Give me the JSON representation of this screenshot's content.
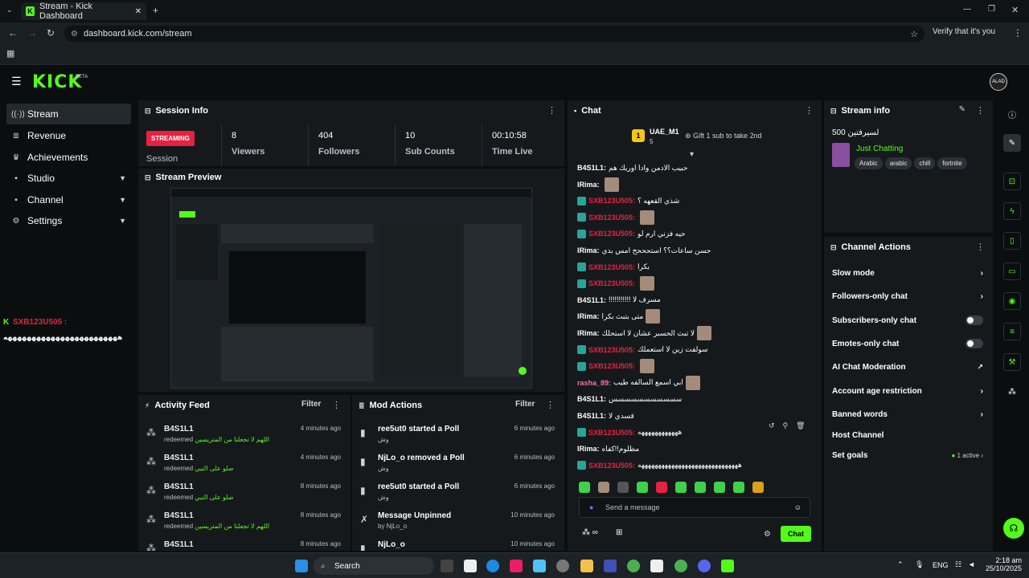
{
  "browser": {
    "tab_title": "Stream - Kick Dashboard",
    "url": "dashboard.kick.com/stream",
    "verify": "Verify that it's you"
  },
  "app": {
    "logo": "KICK",
    "beta": "BETA",
    "avatar": "ALAD"
  },
  "sidebar": {
    "items": [
      {
        "label": "Stream",
        "icon": "broadcast-icon"
      },
      {
        "label": "Revenue",
        "icon": "list-icon"
      },
      {
        "label": "Achievements",
        "icon": "trophy-icon"
      },
      {
        "label": "Studio",
        "icon": "studio-icon"
      },
      {
        "label": "Channel",
        "icon": "channel-icon"
      },
      {
        "label": "Settings",
        "icon": "gear-icon"
      }
    ]
  },
  "session": {
    "title": "Session Info",
    "status": "STREAMING",
    "status_label": "Session",
    "stats": [
      {
        "value": "8",
        "label": "Viewers"
      },
      {
        "value": "404",
        "label": "Followers"
      },
      {
        "value": "10",
        "label": "Sub Counts"
      },
      {
        "value": "00:10:58",
        "label": "Time Live"
      }
    ]
  },
  "preview": {
    "title": "Stream Preview"
  },
  "activity": {
    "title": "Activity Feed",
    "filter": "Filter",
    "rows": [
      {
        "name": "B4S1L1",
        "action": "redeemed",
        "reward": "اللهم لا تجعلنا من المتريسين",
        "time": "4 minutes ago"
      },
      {
        "name": "B4S1L1",
        "action": "redeemed",
        "reward": "صلو على النبي",
        "time": "4 minutes ago"
      },
      {
        "name": "B4S1L1",
        "action": "redeemed",
        "reward": "صلو على النبي",
        "time": "8 minutes ago"
      },
      {
        "name": "B4S1L1",
        "action": "redeemed",
        "reward": "اللهم لا تجعلنا من المتريسين",
        "time": "8 minutes ago"
      },
      {
        "name": "B4S1L1",
        "action": "",
        "reward": "",
        "time": "8 minutes ago"
      }
    ]
  },
  "mod": {
    "title": "Mod Actions",
    "filter": "Filter",
    "rows": [
      {
        "title": "ree5ut0 started a Poll",
        "sub": "وش",
        "time": "6 minutes ago"
      },
      {
        "title": "NjLo_o removed a Poll",
        "sub": "وش",
        "time": "6 minutes ago"
      },
      {
        "title": "ree5ut0 started a Poll",
        "sub": "وش",
        "time": "6 minutes ago"
      },
      {
        "title": "Message Unpinned",
        "sub": "by NjLo_o",
        "time": "10 minutes ago"
      },
      {
        "title": "NjLo_o",
        "sub": "",
        "time": "10 minutes ago"
      }
    ]
  },
  "chat": {
    "title": "Chat",
    "gifter": "UAE_M1",
    "gift_count": "5",
    "gift_button": "Gift 1 sub to take 2nd",
    "messages": [
      {
        "user": "B4S1L1:",
        "text": "حبيب الادمن وادا اوريك هم",
        "color": "white",
        "badge": false,
        "emote": false
      },
      {
        "user": "IRima:",
        "text": "",
        "color": "white",
        "badge": false,
        "emote": true
      },
      {
        "user": "SXB123U505:",
        "text": "شذي القعهه ؟",
        "color": "red",
        "badge": true,
        "emote": false
      },
      {
        "user": "SXB123U505:",
        "text": "",
        "color": "red",
        "badge": true,
        "emote": true
      },
      {
        "user": "SXB123U505:",
        "text": "حيه فزني ارم لو",
        "color": "red",
        "badge": true,
        "emote": false
      },
      {
        "user": "IRima:",
        "text": "حسن ساعات؟؟ استحححح امس بدي",
        "color": "white",
        "badge": false,
        "emote": false
      },
      {
        "user": "SXB123U505:",
        "text": "بكرا",
        "color": "red",
        "badge": true,
        "emote": false
      },
      {
        "user": "SXB123U505:",
        "text": "",
        "color": "red",
        "badge": true,
        "emote": true
      },
      {
        "user": "B4S1L1:",
        "text": "!!!!!!!!!!! مسرف لا",
        "color": "white",
        "badge": false,
        "emote": false
      },
      {
        "user": "IRima:",
        "text": "متى بتبث بكرا",
        "color": "white",
        "badge": false,
        "emote": true
      },
      {
        "user": "IRima:",
        "text": "لا تبث الحسبر عشان لا استحلك",
        "color": "white",
        "badge": false,
        "emote": true
      },
      {
        "user": "SXB123U505:",
        "text": "سولفت زين لا استعملك",
        "color": "red",
        "badge": true,
        "emote": false
      },
      {
        "user": "SXB123U505:",
        "text": "",
        "color": "red",
        "badge": true,
        "emote": true
      },
      {
        "user": "rasha_89:",
        "text": "ابي اسمع السالفه طيب",
        "color": "pink",
        "badge": false,
        "emote": true
      },
      {
        "user": "B4S1L1:",
        "text": "سسسسسسسسسسس",
        "color": "white",
        "badge": false,
        "emote": false
      },
      {
        "user": "B4S1L1:",
        "text": "قسدي لا",
        "color": "white",
        "badge": false,
        "emote": false
      },
      {
        "user": "SXB123U505:",
        "text": "ههههههههههههه",
        "color": "red",
        "badge": true,
        "emote": false
      },
      {
        "user": "IRima:",
        "text": "مظلوم!!كفاه",
        "color": "white",
        "badge": false,
        "emote": false
      },
      {
        "user": "SXB123U505:",
        "text": "ههههههههههههههههههههههههههههههه",
        "color": "red",
        "badge": true,
        "emote": false
      }
    ],
    "input_placeholder": "Send a message",
    "send_label": "Chat",
    "infinity": "∞"
  },
  "streaminfo": {
    "title": "Stream info",
    "stream_title": "لسيرفتين 500",
    "category": "Just Chatting",
    "tags": [
      "Arabic",
      "arabic",
      "chill",
      "fortnite"
    ]
  },
  "actions": {
    "title": "Channel Actions",
    "rows": [
      {
        "label": "Slow mode",
        "kind": "chevron"
      },
      {
        "label": "Followers-only chat",
        "kind": "chevron"
      },
      {
        "label": "Subscribers-only chat",
        "kind": "toggle"
      },
      {
        "label": "Emotes-only chat",
        "kind": "toggle"
      },
      {
        "label": "AI Chat Moderation",
        "kind": "external"
      },
      {
        "label": "Account age restriction",
        "kind": "chevron"
      },
      {
        "label": "Banned words",
        "kind": "chevron"
      },
      {
        "label": "Host Channel",
        "kind": "none"
      },
      {
        "label": "Set goals",
        "kind": "goal",
        "extra": "1 active"
      }
    ]
  },
  "overlay": {
    "user": "SXB123U505 :",
    "text": "ههههههههههههههههههههههههه"
  },
  "taskbar": {
    "search": "Search",
    "lang": "ENG",
    "time": "2:18 am",
    "date": "25/10/2025"
  },
  "colors": {
    "accent": "#53fc18",
    "live": "#e5223f",
    "panel": "#15191c"
  }
}
